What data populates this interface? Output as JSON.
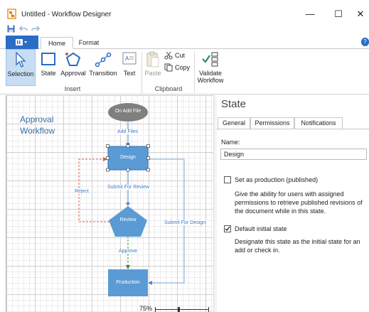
{
  "window": {
    "title": "Untitled - Workflow Designer",
    "minimize": "—",
    "maximize": "☐",
    "close": "✕"
  },
  "qat": {
    "save": "save-icon",
    "undo": "undo-icon",
    "redo": "redo-icon"
  },
  "ribbon": {
    "tabs": [
      "Home",
      "Format"
    ],
    "active_tab": "Home",
    "help": "?",
    "buttons": {
      "selection": "Selection",
      "state": "State",
      "approval": "Approval",
      "transition": "Transition",
      "text": "Text",
      "paste": "Paste",
      "cut": "Cut",
      "copy": "Copy",
      "validate": "Validate Workflow"
    },
    "groups": {
      "insert": "Insert",
      "clipboard": "Clipboard"
    }
  },
  "canvas": {
    "title": "Approval Workflow",
    "nodes": {
      "start": "On Add File",
      "design": "Design",
      "review": "Review",
      "production": "Production"
    },
    "edges": {
      "add_files": "Add Files",
      "submit_for_review": "Submit For Review",
      "reject": "Reject",
      "approve": "Approve",
      "submit_for_design": "Submit For Design"
    },
    "zoom": "75%"
  },
  "properties": {
    "title": "State",
    "tabs": [
      "General",
      "Permissions",
      "Notifications"
    ],
    "active_tab": "General",
    "name_label": "Name:",
    "name_value": "Design",
    "production_label": "Set as production (published)",
    "production_checked": false,
    "production_desc": "Give the ability for users with assigned permissions to retrieve published revisions of the document while in this state.",
    "default_label": "Default initial state",
    "default_checked": true,
    "default_desc": "Designate this state as the initial state for an add or check in."
  },
  "colors": {
    "accent": "#2b6cc4",
    "node_fill": "#5b9bd5",
    "start_fill": "#7f7f7f",
    "reject_line": "#e05a4a",
    "approve_line": "#5aa55a",
    "flow_line": "#4a86c8",
    "canvas_title": "#3a6ea8"
  }
}
